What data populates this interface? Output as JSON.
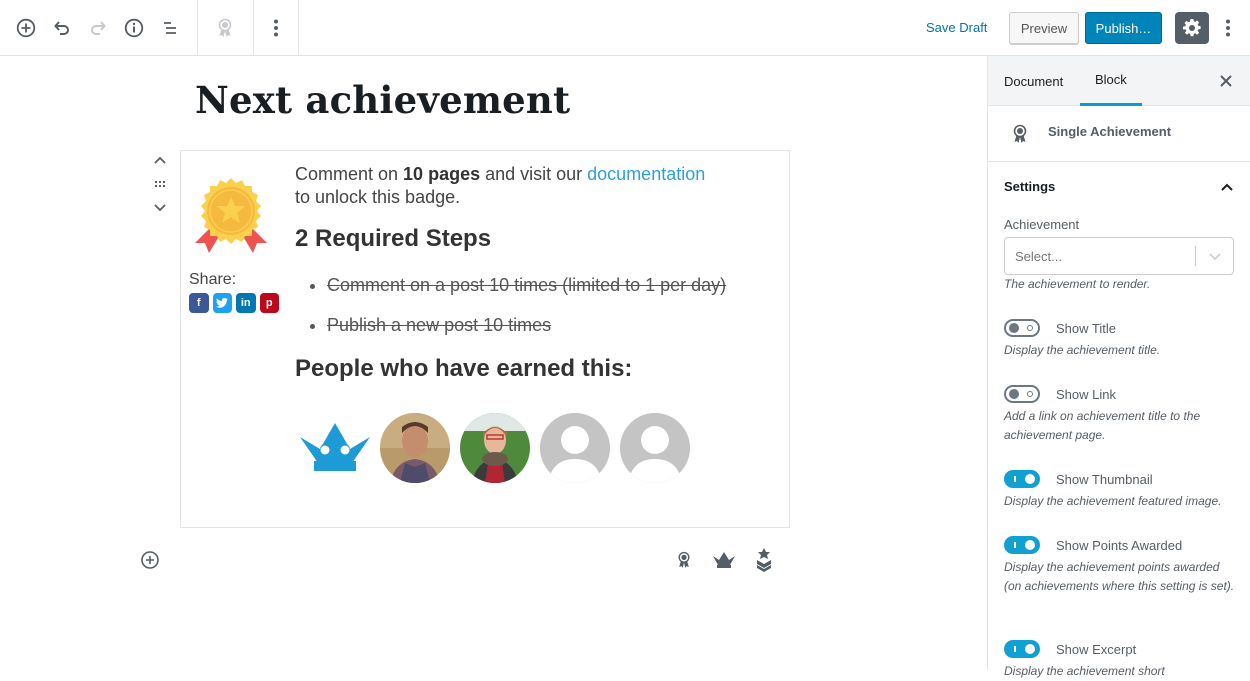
{
  "toolbar": {
    "save_draft": "Save Draft",
    "preview": "Preview",
    "publish": "Publish…",
    "accent_color": "#0085ba"
  },
  "post": {
    "title": "Next achievement"
  },
  "achievement_block": {
    "description_before": "Comment on ",
    "description_bold": "10 pages",
    "description_middle": " and visit our ",
    "description_link": "documentation",
    "description_after": " to unlock this badge.",
    "share_label": "Share:",
    "share_buttons": [
      {
        "network": "facebook",
        "glyph": "f",
        "color": "#3b5998"
      },
      {
        "network": "twitter",
        "glyph": "t",
        "color": "#1da1f2"
      },
      {
        "network": "linkedin",
        "glyph": "in",
        "color": "#0077b5"
      },
      {
        "network": "pinterest",
        "glyph": "p",
        "color": "#bd081c"
      }
    ],
    "steps_heading": "2 Required Steps",
    "steps": [
      "Comment on a post 10 times (limited to 1 per day)",
      "Publish a new post 10 times"
    ],
    "earned_heading": "People who have earned this:",
    "earners": [
      {
        "type": "crown-avatar"
      },
      {
        "type": "photo-man"
      },
      {
        "type": "photo-woman"
      },
      {
        "type": "default-avatar"
      },
      {
        "type": "default-avatar"
      }
    ]
  },
  "sidebar": {
    "tabs": [
      {
        "label": "Document",
        "active": false
      },
      {
        "label": "Block",
        "active": true
      }
    ],
    "block_card_title": "Single Achievement",
    "panel_title": "Settings",
    "achievement_field": {
      "label": "Achievement",
      "placeholder": "Select...",
      "help": "The achievement to render."
    },
    "toggles": [
      {
        "label": "Show Title",
        "on": false,
        "help": "Display the achievement title."
      },
      {
        "label": "Show Link",
        "on": false,
        "help": "Add a link on achievement title to the achievement page."
      },
      {
        "label": "Show Thumbnail",
        "on": true,
        "help": "Display the achievement featured image."
      },
      {
        "label": "Show Points Awarded",
        "on": true,
        "help": "Display the achievement points awarded (on achievements where this setting is set)."
      },
      {
        "label": "Show Excerpt",
        "on": true,
        "help": "Display the achievement short"
      }
    ]
  }
}
